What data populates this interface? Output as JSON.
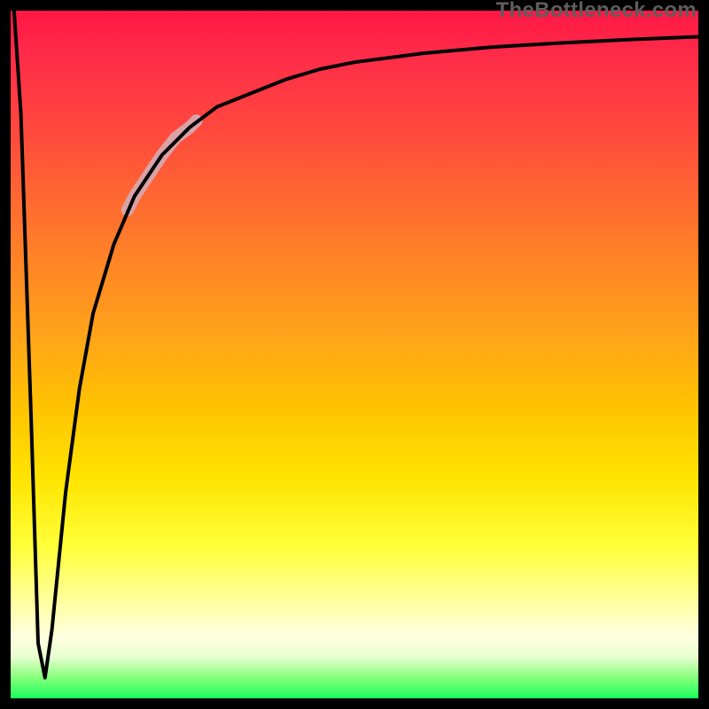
{
  "watermark": "TheBottleneck.com",
  "chart_data": {
    "type": "line",
    "title": "",
    "xlabel": "",
    "ylabel": "",
    "xlim": [
      0,
      100
    ],
    "ylim": [
      0,
      100
    ],
    "grid": false,
    "legend": false,
    "series": [
      {
        "name": "bottleneck-curve",
        "x": [
          0.5,
          1.5,
          3,
          4,
          5,
          6,
          8,
          10,
          12,
          15,
          18,
          22,
          26,
          30,
          35,
          40,
          45,
          50,
          60,
          70,
          80,
          90,
          100
        ],
        "y": [
          100,
          85,
          40,
          8,
          3,
          10,
          30,
          45,
          56,
          66,
          73,
          79,
          83,
          86,
          88,
          90,
          91.5,
          92.5,
          93.8,
          94.7,
          95.3,
          95.8,
          96.2
        ],
        "note": "Curve drops sharply from top-left to a near-zero minimum around x≈4, then rises asymptotically toward ~96% at the right edge."
      },
      {
        "name": "highlight-band",
        "x": [
          17,
          18,
          20,
          22,
          24,
          26,
          27
        ],
        "y": [
          71,
          73,
          76,
          79,
          81.5,
          83,
          84
        ],
        "note": "Thicker light-pink emphasis segment along the rising part of the curve."
      }
    ],
    "annotation": "Background is a vertical heatmap gradient: red (top) → orange → yellow → pale yellow → green (bottom)."
  }
}
